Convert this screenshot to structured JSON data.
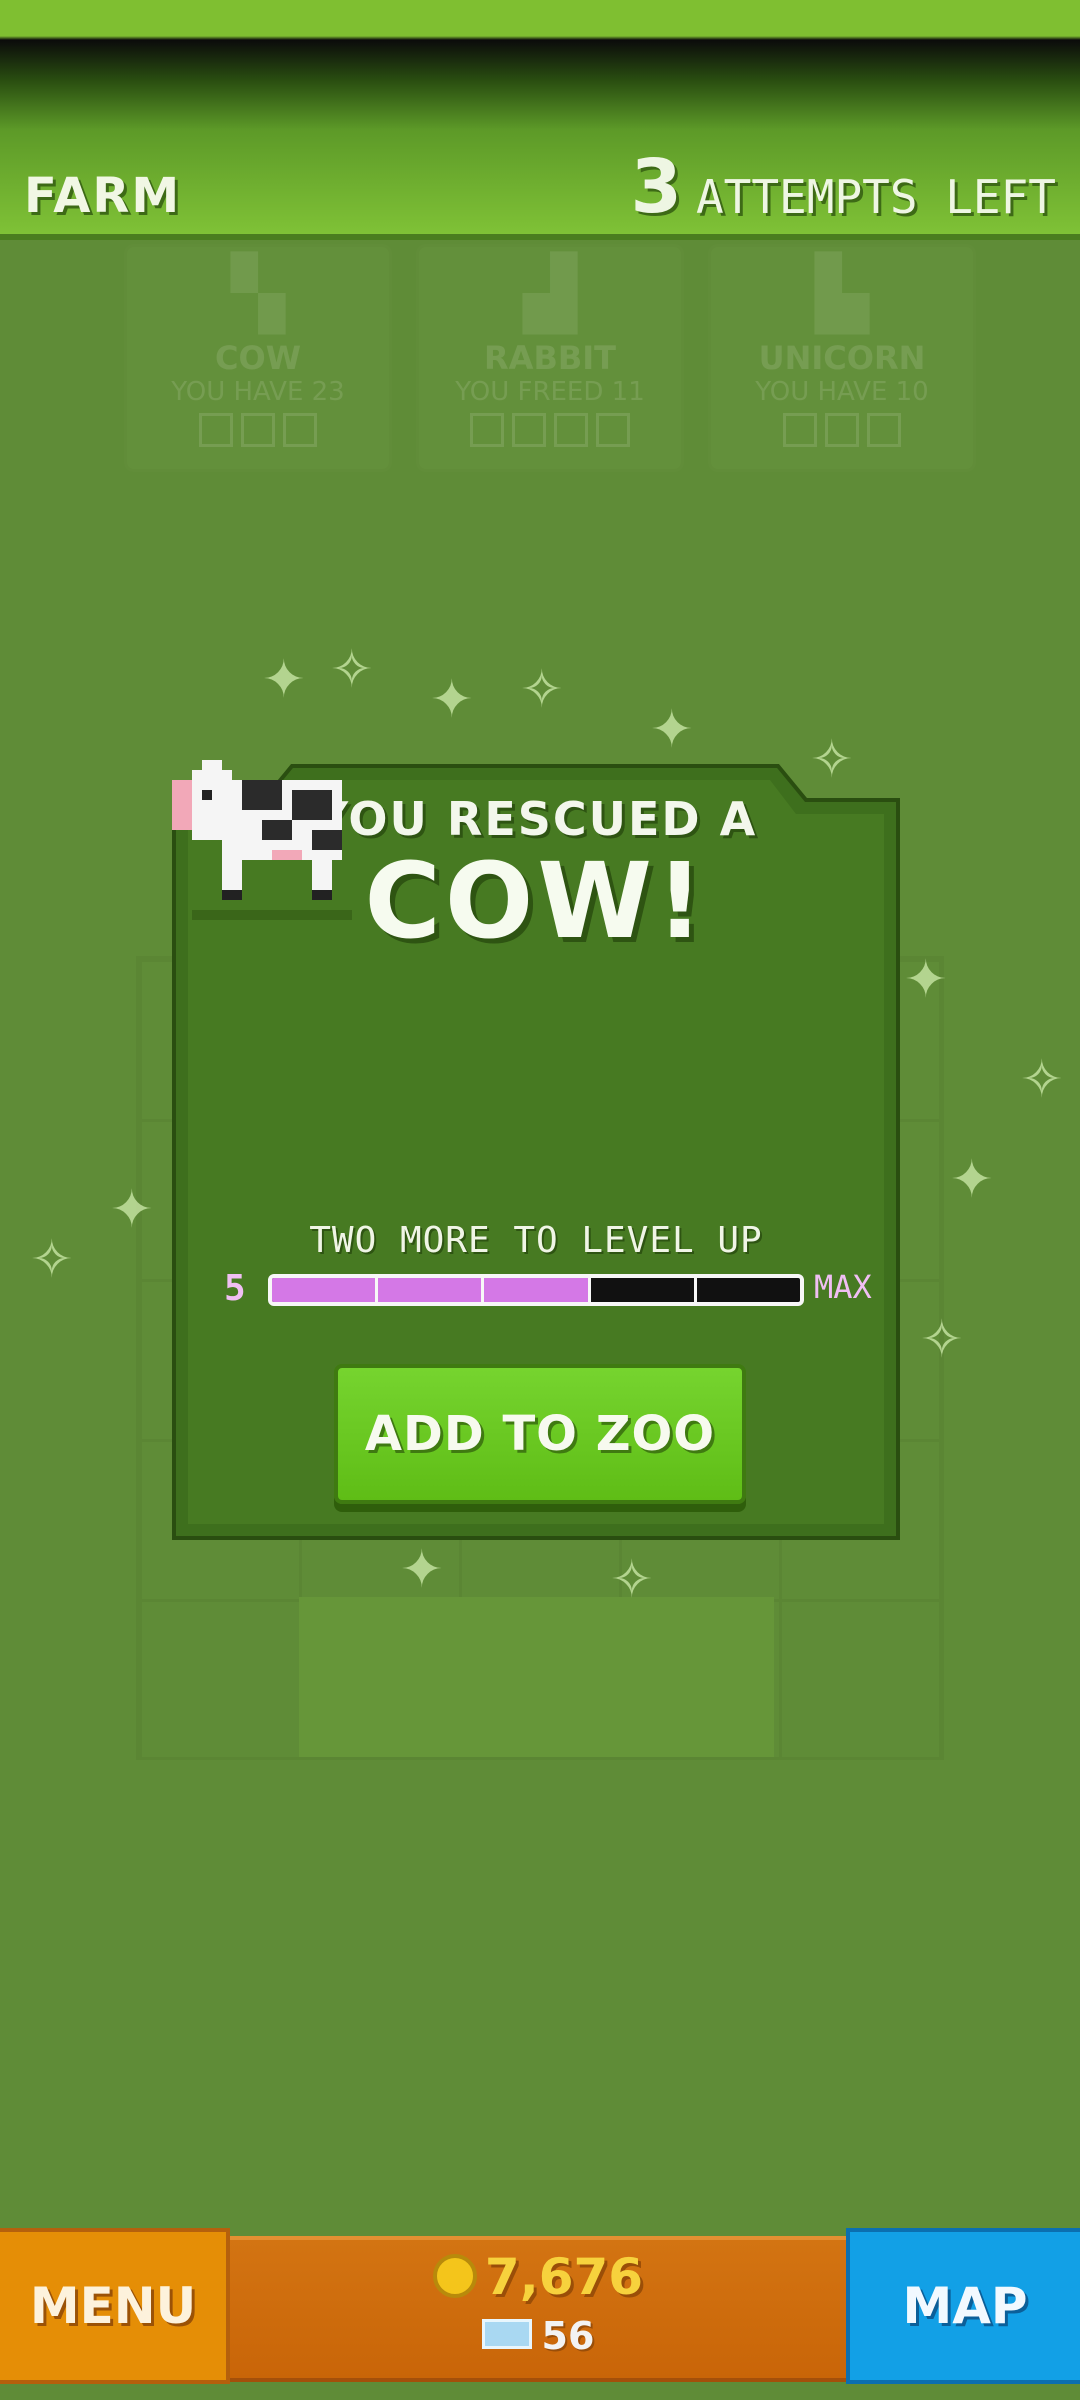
{
  "header": {
    "area_label": "FARM",
    "attempts_count": "3",
    "attempts_label": "ATTEMPTS LEFT"
  },
  "collection_cards": [
    {
      "name": "COW",
      "sub": "YOU HAVE 23",
      "icon": "cow-icon"
    },
    {
      "name": "RABBIT",
      "sub": "YOU FREED 11",
      "icon": "rabbit-icon"
    },
    {
      "name": "UNICORN",
      "sub": "YOU HAVE 10",
      "icon": "unicorn-icon"
    }
  ],
  "modal": {
    "rescued_text": "YOU RESCUED A",
    "animal_name": "COW!",
    "level_text": "TWO MORE TO LEVEL UP",
    "level": "5",
    "max_label": "MAX",
    "progress_segments_filled": 3,
    "progress_segments_total": 5,
    "progress_fill_color": "#d478e6",
    "add_button": "ADD TO ZOO"
  },
  "footer": {
    "menu_label": "MENU",
    "coins": "7,676",
    "gems": "56",
    "map_label": "MAP"
  },
  "colors": {
    "background": "#5f8c37",
    "topbar": "#81c437",
    "menu_button": "#e58e06",
    "map_button": "#12a0e6",
    "add_button": "#6cc925"
  }
}
